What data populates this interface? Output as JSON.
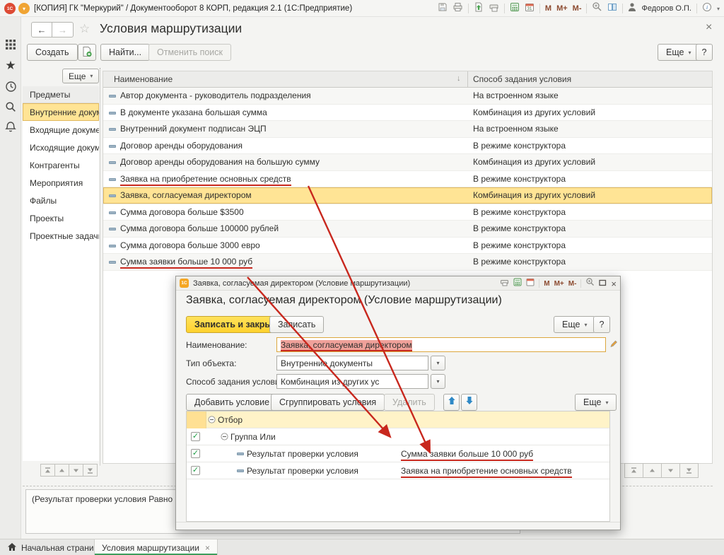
{
  "glyphs": {
    "chevron_down": "▾",
    "sort_desc": "↓",
    "close": "×",
    "check": "✓",
    "back": "←",
    "forward": "→",
    "star_outline": "☆",
    "m": "M",
    "m_plus": "M+",
    "m_minus": "M-"
  },
  "app": {
    "title": "[КОПИЯ] ГК \"Меркурий\" / Документооборот 8 КОРП, редакция 2.1  (1С:Предприятие)",
    "logo": "1С",
    "user": "Федоров О.П."
  },
  "page": {
    "title": "Условия маршрутизации",
    "toolbar": {
      "create": "Создать",
      "find": "Найти...",
      "cancel_search": "Отменить поиск",
      "more": "Еще",
      "help": "?"
    }
  },
  "sidebar": {
    "more": "Еще",
    "header": "Предметы",
    "items": [
      {
        "label": "Внутренние документы",
        "selected": true
      },
      {
        "label": "Входящие документы"
      },
      {
        "label": "Исходящие документы"
      },
      {
        "label": "Контрагенты"
      },
      {
        "label": "Мероприятия"
      },
      {
        "label": "Файлы"
      },
      {
        "label": "Проекты"
      },
      {
        "label": "Проектные задачи"
      }
    ]
  },
  "table": {
    "columns": [
      "Наименование",
      "Способ задания условия"
    ],
    "rows": [
      {
        "name": "Автор документа - руководитель подразделения",
        "method": "На встроенном языке"
      },
      {
        "name": "В документе указана большая сумма",
        "method": "Комбинация из других условий"
      },
      {
        "name": "Внутренний документ подписан ЭЦП",
        "method": "На встроенном языке"
      },
      {
        "name": "Договор аренды оборудования",
        "method": "В режиме конструктора"
      },
      {
        "name": "Договор аренды оборудования на большую сумму",
        "method": "Комбинация из других условий"
      },
      {
        "name": "Заявка на приобретение основных средств",
        "method": "В режиме конструктора",
        "annotated": true
      },
      {
        "name": "Заявка, согласуемая директором",
        "method": "Комбинация из других условий",
        "selected": true
      },
      {
        "name": "Сумма договора больше $3500",
        "method": "В режиме конструктора"
      },
      {
        "name": "Сумма договора больше 100000 рублей",
        "method": "В режиме конструктора"
      },
      {
        "name": "Сумма договора больше 3000 евро",
        "method": "В режиме конструктора"
      },
      {
        "name": "Сумма заявки больше 10 000 руб",
        "method": "В режиме конструктора",
        "annotated": true
      }
    ]
  },
  "status": "(Результат проверки условия Равно \"Сумм",
  "dialog": {
    "badge": "1С",
    "titlebar": "Заявка, согласуемая директором (Условие маршрутизации)",
    "heading": "Заявка, согласуемая директором (Условие маршрутизации)",
    "buttons": {
      "save_close": "Записать и закрыть",
      "save": "Записать",
      "more": "Еще",
      "help": "?"
    },
    "fields": {
      "name_label": "Наименование:",
      "name_value": "Заявка, согласуемая директором",
      "type_label": "Тип объекта:",
      "type_value": "Внутренние документы",
      "method_label": "Способ задания условия:",
      "method_value": "Комбинация из других ус"
    },
    "toolbar": {
      "add": "Добавить условие",
      "group": "Сгруппировать условия",
      "remove": "Удалить",
      "more": "Еще"
    },
    "tree": {
      "root": "Отбор",
      "group": "Группа Или",
      "rows": [
        {
          "label": "Результат проверки условия",
          "value": "Сумма заявки больше 10 000 руб",
          "annotated": true
        },
        {
          "label": "Результат проверки условия",
          "value": "Заявка на приобретение основных средств",
          "annotated": true
        }
      ]
    }
  },
  "tabs": [
    {
      "label": "Начальная страница",
      "home": true
    },
    {
      "label": "Условия маршрутизации",
      "active": true,
      "closable": true
    }
  ],
  "colors": {
    "selection_yellow": "#FFE495",
    "annotation_red": "#C8281E",
    "tab_active_green": "#3E9E5D",
    "save_button_yellow": "#FFD943"
  }
}
